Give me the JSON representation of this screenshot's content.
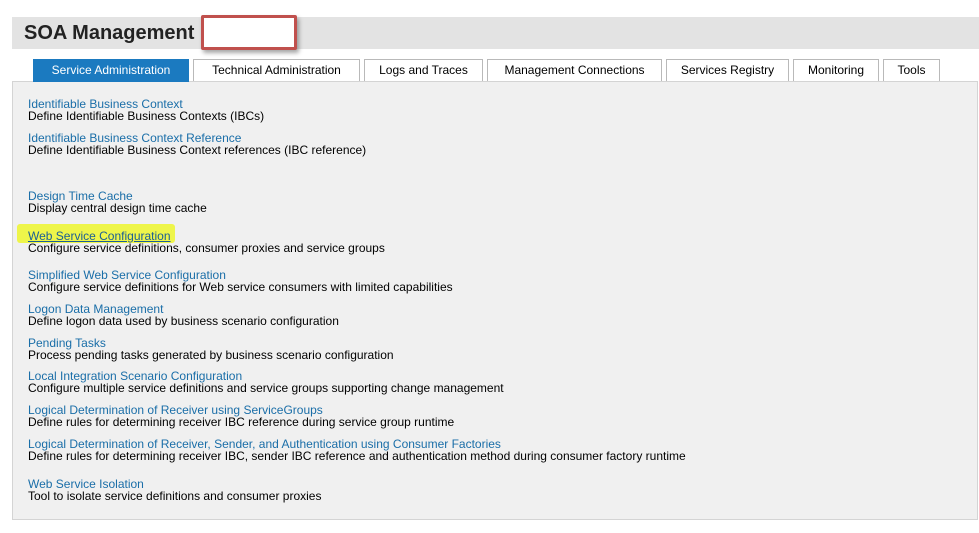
{
  "app": {
    "title": "SOA Management"
  },
  "tabs": [
    {
      "label": "Service Administration",
      "active": true
    },
    {
      "label": "Technical Administration",
      "active": false
    },
    {
      "label": "Logs and Traces",
      "active": false
    },
    {
      "label": "Management Connections",
      "active": false
    },
    {
      "label": "Services Registry",
      "active": false
    },
    {
      "label": "Monitoring",
      "active": false
    },
    {
      "label": "Tools",
      "active": false
    }
  ],
  "items": [
    {
      "link": "Identifiable Business Context",
      "desc": "Define Identifiable Business Contexts (IBCs)"
    },
    {
      "link": "Identifiable Business Context Reference",
      "desc": "Define Identifiable Business Context references (IBC reference)"
    },
    {
      "link": "Design Time Cache",
      "desc": "Display central design time cache"
    },
    {
      "link": "Web Service Configuration",
      "desc": "Configure service definitions, consumer proxies and service groups"
    },
    {
      "link": "Simplified Web Service Configuration",
      "desc": "Configure service definitions for Web service consumers with limited capabilities"
    },
    {
      "link": "Logon Data Management",
      "desc": "Define logon data used by business scenario configuration"
    },
    {
      "link": "Pending Tasks",
      "desc": "Process pending tasks generated by business scenario configuration"
    },
    {
      "link": "Local Integration Scenario Configuration",
      "desc": "Configure multiple service definitions and service groups supporting change management"
    },
    {
      "link": "Logical Determination of Receiver using ServiceGroups",
      "desc": "Define rules for determining receiver IBC reference during service group runtime"
    },
    {
      "link": "Logical Determination of Receiver, Sender, and Authentication using Consumer Factories",
      "desc": "Define rules for determining receiver IBC, sender IBC reference and authentication method during consumer factory runtime"
    },
    {
      "link": "Web Service Isolation",
      "desc": "Tool to isolate service definitions and consumer proxies"
    }
  ],
  "colors": {
    "accent": "#1b7ac0",
    "link": "#1a6ea8",
    "highlight": "#eef54a",
    "annotation_border": "#c0504d"
  }
}
